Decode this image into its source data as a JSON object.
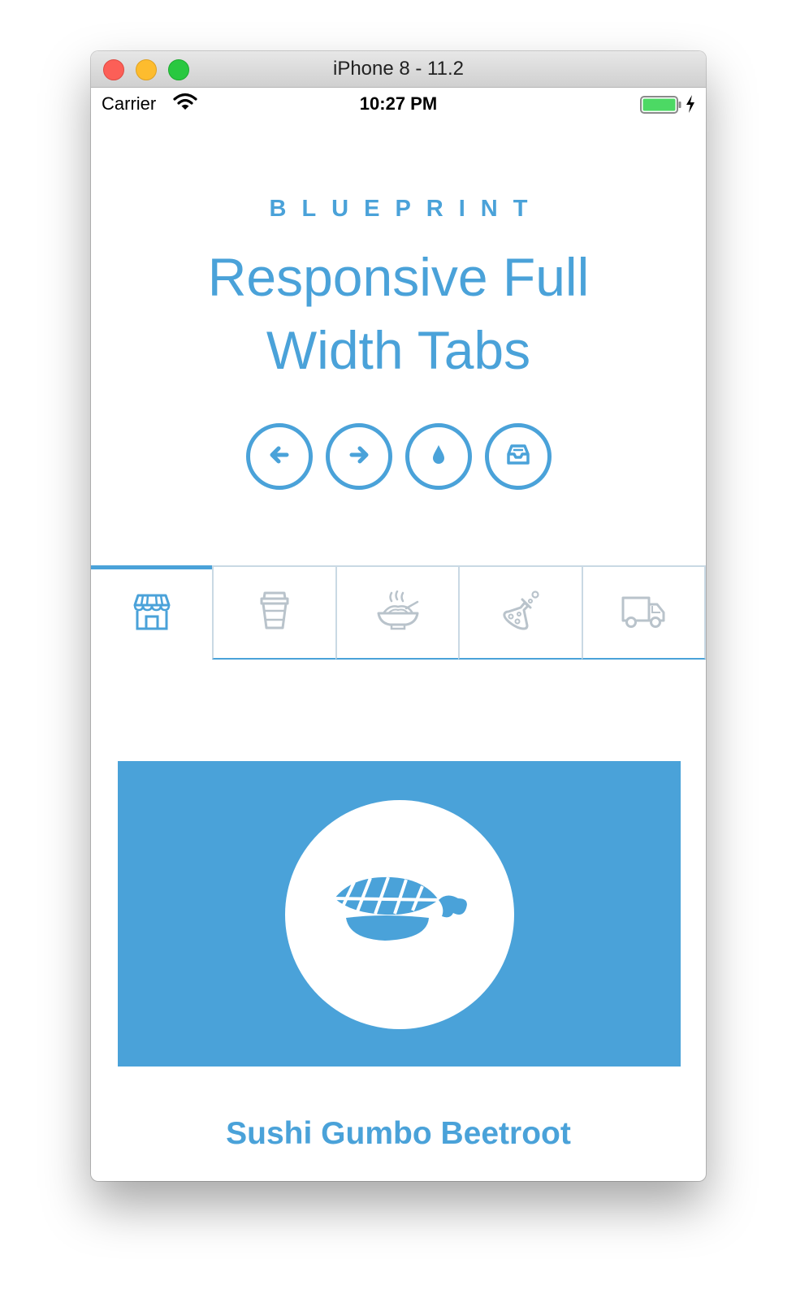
{
  "window": {
    "title": "iPhone 8 - 11.2"
  },
  "status_bar": {
    "carrier": "Carrier",
    "time": "10:27 PM"
  },
  "header": {
    "eyebrow": "BLUEPRINT",
    "title_line1": "Responsive Full",
    "title_line2": "Width Tabs"
  },
  "round_buttons": [
    {
      "icon": "arrow-left-icon"
    },
    {
      "icon": "arrow-right-icon"
    },
    {
      "icon": "drop-icon"
    },
    {
      "icon": "inbox-icon"
    }
  ],
  "tabs": [
    {
      "icon": "shop-icon",
      "active": true
    },
    {
      "icon": "cup-icon",
      "active": false
    },
    {
      "icon": "noodles-icon",
      "active": false
    },
    {
      "icon": "flask-icon",
      "active": false
    },
    {
      "icon": "truck-icon",
      "active": false
    }
  ],
  "content": {
    "icon": "sushi-icon",
    "title": "Sushi Gumbo Beetroot"
  },
  "colors": {
    "accent": "#4aa2d9",
    "tab_border": "#c9d9e4",
    "inactive_icon": "#b9c3cb"
  }
}
